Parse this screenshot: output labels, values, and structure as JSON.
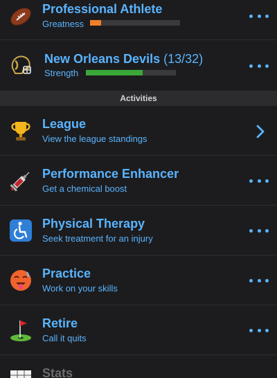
{
  "career": {
    "title": "Professional Athlete",
    "stat_label": "Greatness",
    "stat_value": 0.12,
    "stat_color": "#f07f28"
  },
  "team": {
    "name": "New Orleans Devils",
    "record": "(13/32)",
    "stat_label": "Strength",
    "stat_value": 0.63,
    "stat_color": "#3aa838"
  },
  "section": {
    "label": "Activities"
  },
  "activities": [
    {
      "title": "League",
      "subtitle": "View the league standings",
      "icon": "trophy-icon",
      "action": "chevron"
    },
    {
      "title": "Performance Enhancer",
      "subtitle": "Get a chemical boost",
      "icon": "syringe-icon",
      "action": "more"
    },
    {
      "title": "Physical Therapy",
      "subtitle": "Seek treatment for an injury",
      "icon": "wheelchair-icon",
      "action": "more"
    },
    {
      "title": "Practice",
      "subtitle": "Work on your skills",
      "icon": "hot-face-icon",
      "action": "more"
    },
    {
      "title": "Retire",
      "subtitle": "Call it quits",
      "icon": "golf-flag-icon",
      "action": "more"
    },
    {
      "title": "Stats",
      "subtitle": "",
      "icon": "calendar-icon",
      "action": "none"
    }
  ],
  "colors": {
    "accent": "#5ab4ff",
    "background": "#1c1c1e",
    "header": "#2c2c2e"
  }
}
